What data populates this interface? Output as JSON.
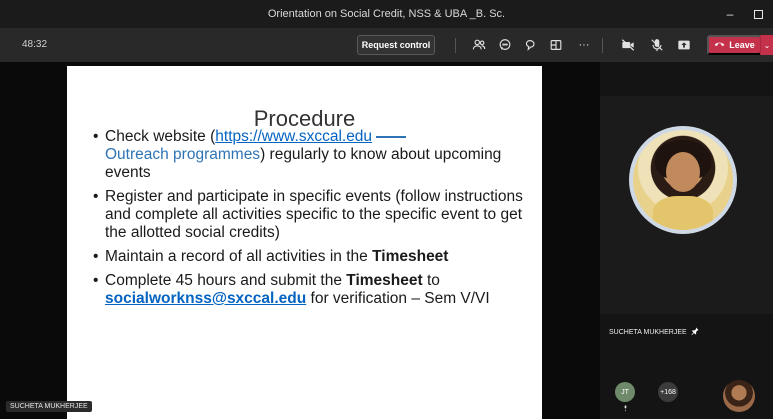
{
  "window": {
    "title": "Orientation on Social Credit, NSS & UBA _B. Sc."
  },
  "toolbar": {
    "timer": "48:32",
    "request_control": "Request control",
    "more": "···",
    "leave": "Leave"
  },
  "slide": {
    "title": "Procedure",
    "b1_pre": "Check website (",
    "b1_link": "https://www.sxccal.edu",
    "b1_link2": "Outreach programmes",
    "b1_post": ") regularly to know about upcoming events",
    "b2": "Register and participate in specific events (follow instructions and complete all activities specific to the specific event to get the allotted social credits)",
    "b3_pre": "Maintain a record of all activities in the ",
    "b3_bold": "Timesheet",
    "b4_pre": "Complete 45 hours and submit the ",
    "b4_bold": "Timesheet",
    "b4_mid": " to ",
    "b4_link": "socialworknss@sxccal.edu",
    "b4_post": " for verification – Sem V/VI"
  },
  "presenter": {
    "name": "SUCHETA MUKHERJEE"
  },
  "side": {
    "participant_name": "SUCHETA MUKHERJEE",
    "initials": "JT",
    "more_count": "+168"
  },
  "colors": {
    "leave": "#c4314b",
    "link": "#0563c1"
  }
}
